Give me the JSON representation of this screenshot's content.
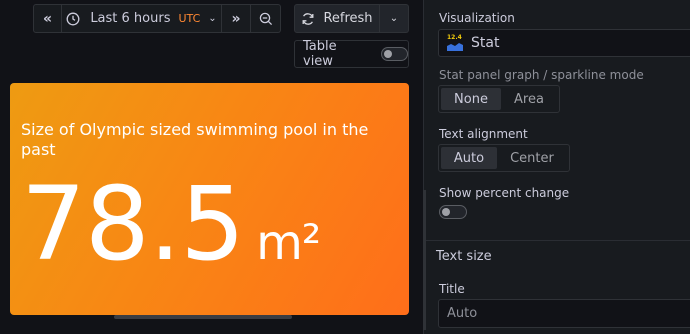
{
  "toolbar": {
    "time_range": "Last 6 hours",
    "timezone": "UTC",
    "refresh_label": "Refresh",
    "table_view_label": "Table view"
  },
  "panel": {
    "title": "Size of Olympic sized swimming pool in the past",
    "value": "78.5",
    "unit": "m²",
    "color_start": "#ee9b12",
    "color_end": "#ff6e1a"
  },
  "options": {
    "visualization_label": "Visualization",
    "visualization_value": "Stat",
    "stat_icon_text": "12.4",
    "graph_mode_label": "Stat panel graph / sparkline mode",
    "graph_mode_options": [
      "None",
      "Area"
    ],
    "graph_mode_selected": "None",
    "text_alignment_label": "Text alignment",
    "text_alignment_options": [
      "Auto",
      "Center"
    ],
    "text_alignment_selected": "Auto",
    "show_percent_change_label": "Show percent change",
    "text_size_section": "Text size",
    "title_label": "Title",
    "title_placeholder": "Auto"
  }
}
